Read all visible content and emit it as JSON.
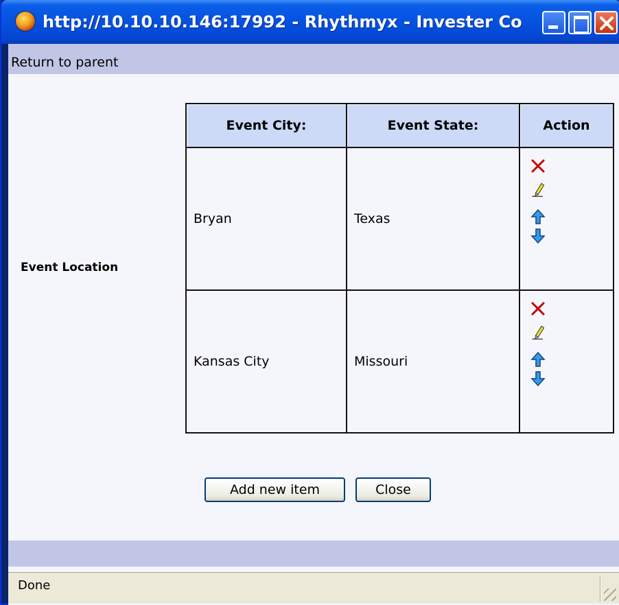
{
  "window": {
    "title": "http://10.10.10.146:17992 - Rhythmyx - Invester Co..."
  },
  "nav": {
    "return_label": "Return to parent"
  },
  "field": {
    "label": "Event Location"
  },
  "table": {
    "headers": [
      "Event City:",
      "Event State:",
      "Action"
    ],
    "rows": [
      {
        "city": "Bryan",
        "state": "Texas"
      },
      {
        "city": "Kansas City",
        "state": "Missouri"
      }
    ]
  },
  "buttons": {
    "add_label": "Add new item",
    "close_label": "Close"
  },
  "status": {
    "text": "Done"
  },
  "colors": {
    "title_bar": "#0551e0",
    "header_cell": "#ccdaf8",
    "strip": "#c2c6e6",
    "delete_icon": "#c00000",
    "arrow_icon": "#1e90ff"
  },
  "icons": [
    "firefox-icon",
    "minimize-icon",
    "maximize-icon",
    "close-icon",
    "delete-icon",
    "edit-icon",
    "move-up-icon",
    "move-down-icon"
  ]
}
